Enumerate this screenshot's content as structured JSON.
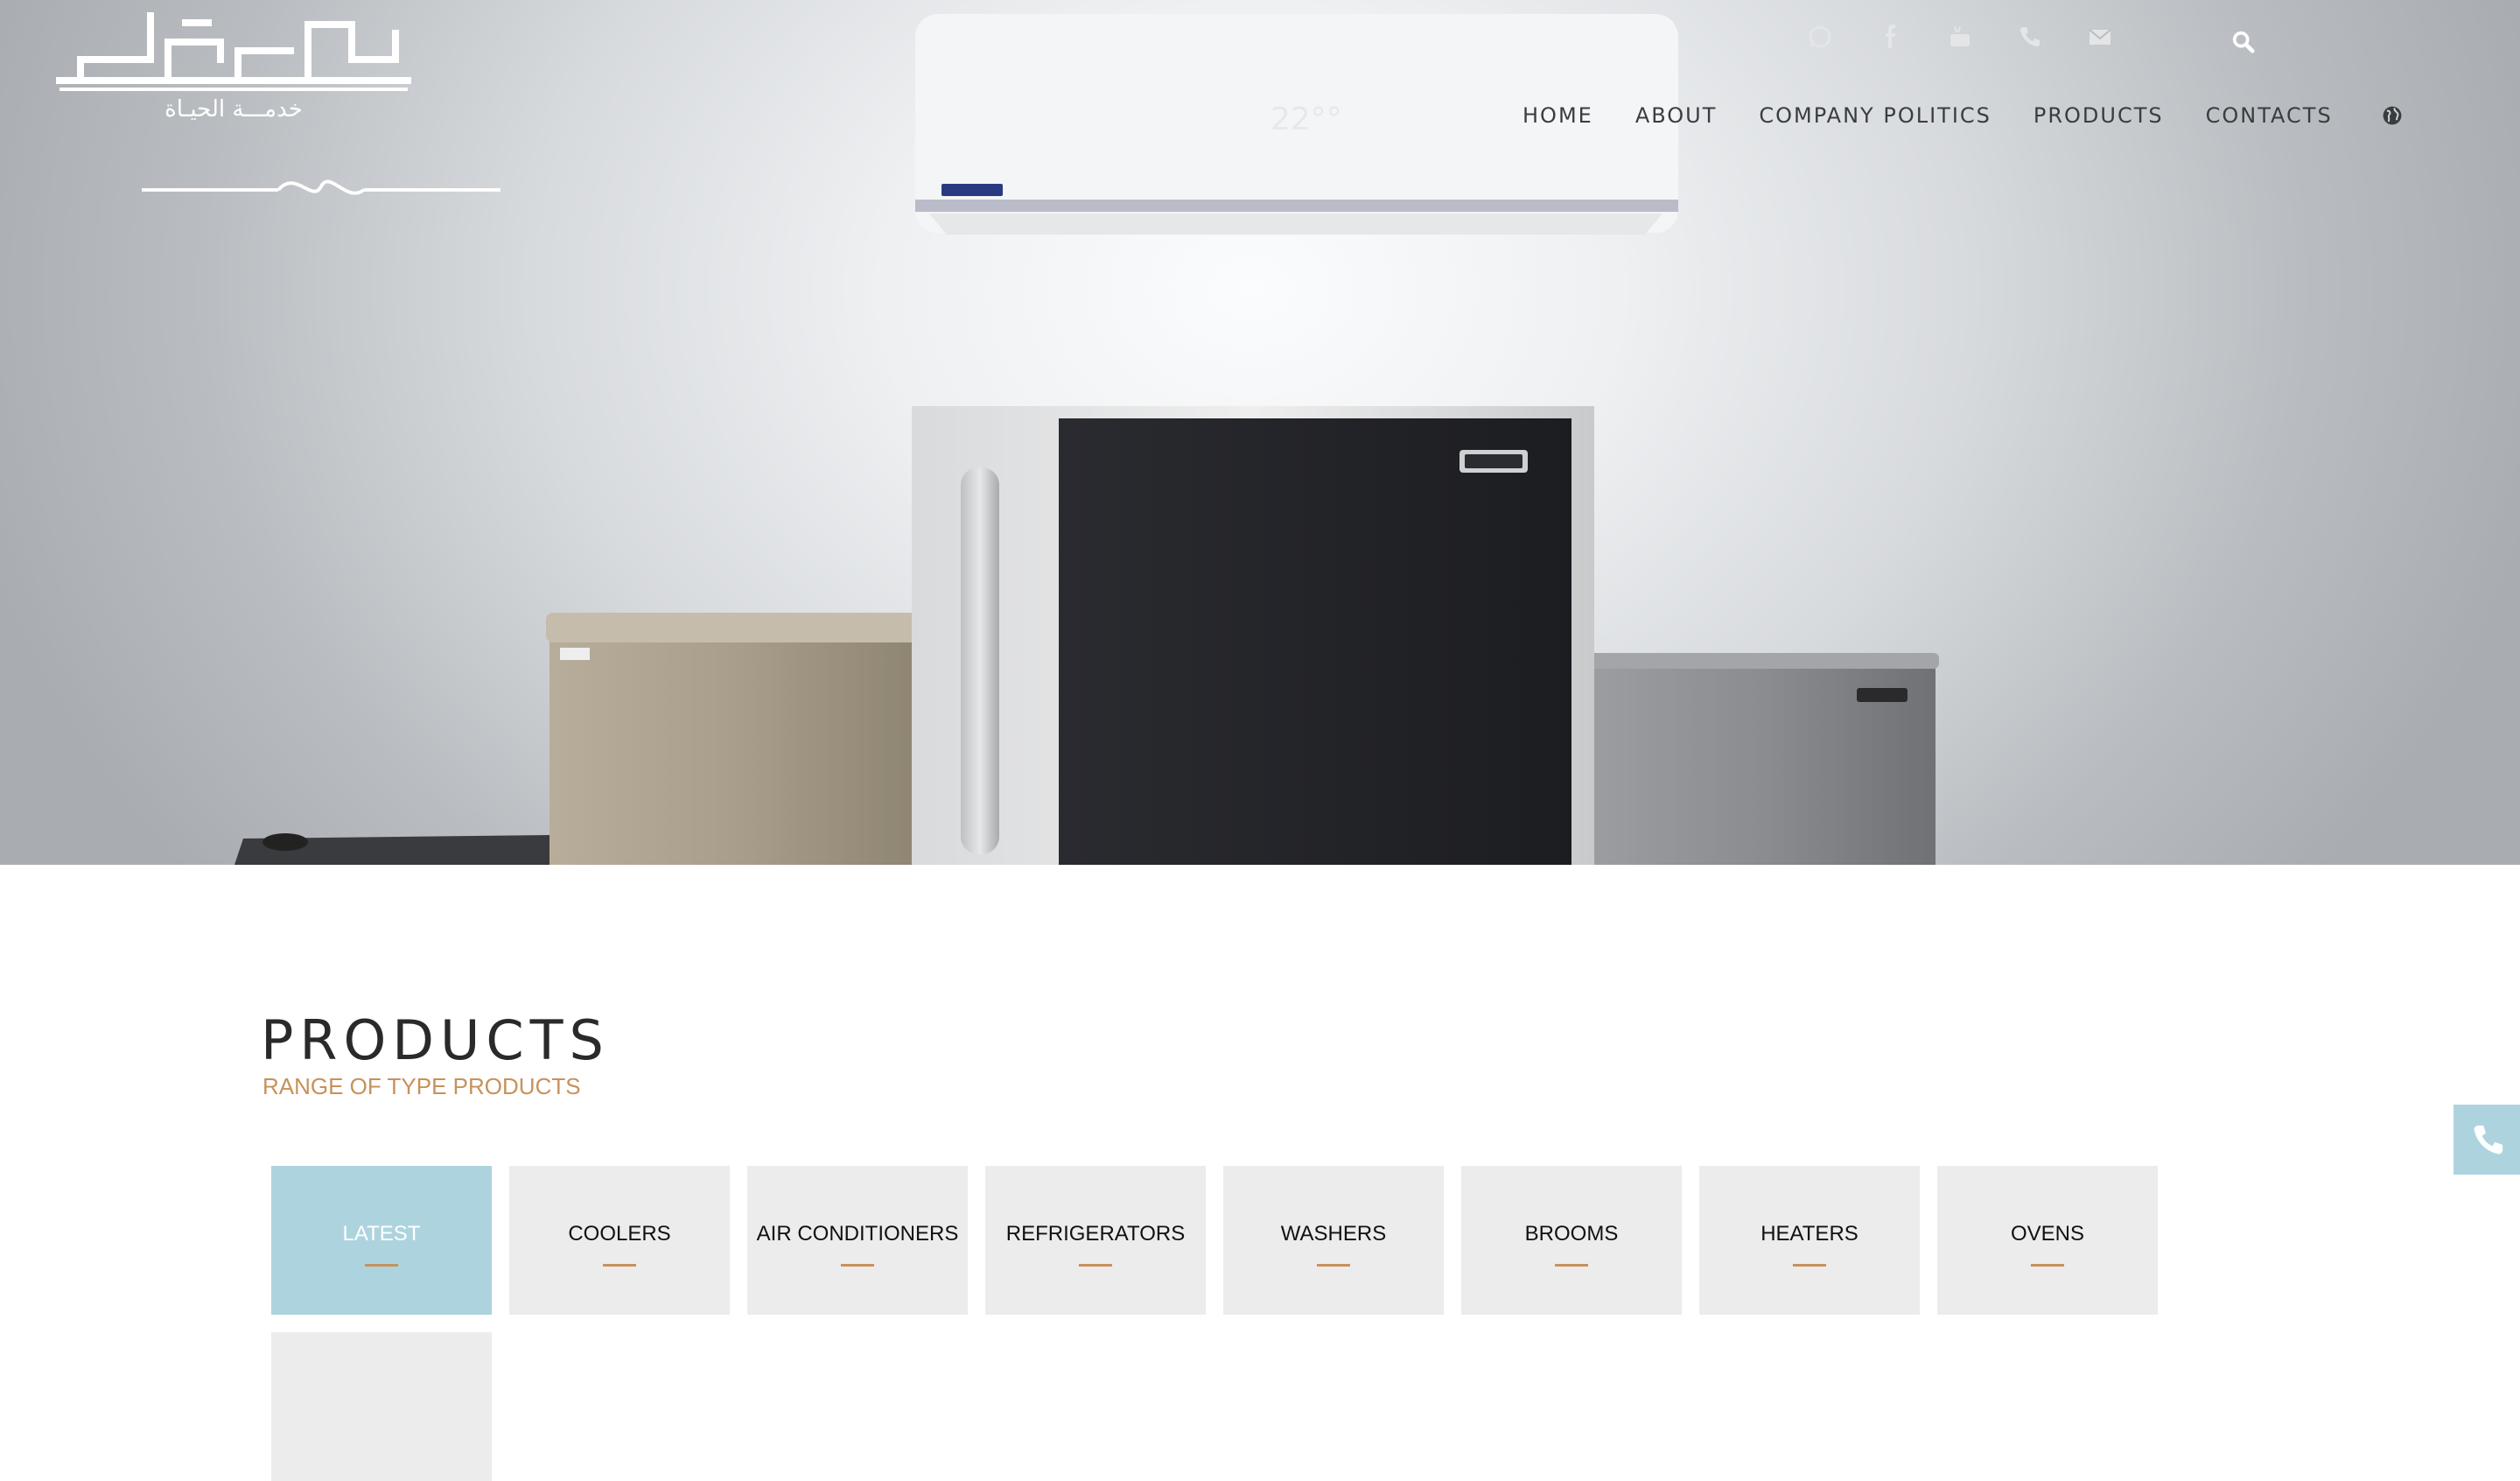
{
  "brand": {
    "tagline": "خدمـــة الحيـاة",
    "logo_icon": "brand-logo"
  },
  "hero": {
    "ac_display": "22°°"
  },
  "top_icons": [
    "whatsapp-icon",
    "facebook-icon",
    "youtube-icon",
    "phone-icon",
    "mail-icon",
    "search-icon"
  ],
  "nav": {
    "items": [
      {
        "label": "HOME"
      },
      {
        "label": "ABOUT"
      },
      {
        "label": "COMPANY POLITICS"
      },
      {
        "label": "PRODUCTS"
      },
      {
        "label": "CONTACTS"
      }
    ],
    "language_icon": "globe-icon"
  },
  "products": {
    "title": "PRODUCTS",
    "subtitle": "RANGE OF TYPE PRODUCTS",
    "tabs": [
      {
        "label": "LATEST",
        "active": true
      },
      {
        "label": "COOLERS"
      },
      {
        "label": "AIR CONDITIONERS"
      },
      {
        "label": "REFRIGERATORS"
      },
      {
        "label": "WASHERS"
      },
      {
        "label": "BROOMS"
      },
      {
        "label": "HEATERS"
      },
      {
        "label": "OVENS"
      },
      {
        "label": ""
      }
    ]
  },
  "colors": {
    "accent": "#c8915b",
    "tab_active": "#add4de",
    "tab_bg": "#ececec",
    "nav_text": "#3a3d40"
  },
  "floating": {
    "phone_icon": "phone-icon"
  }
}
